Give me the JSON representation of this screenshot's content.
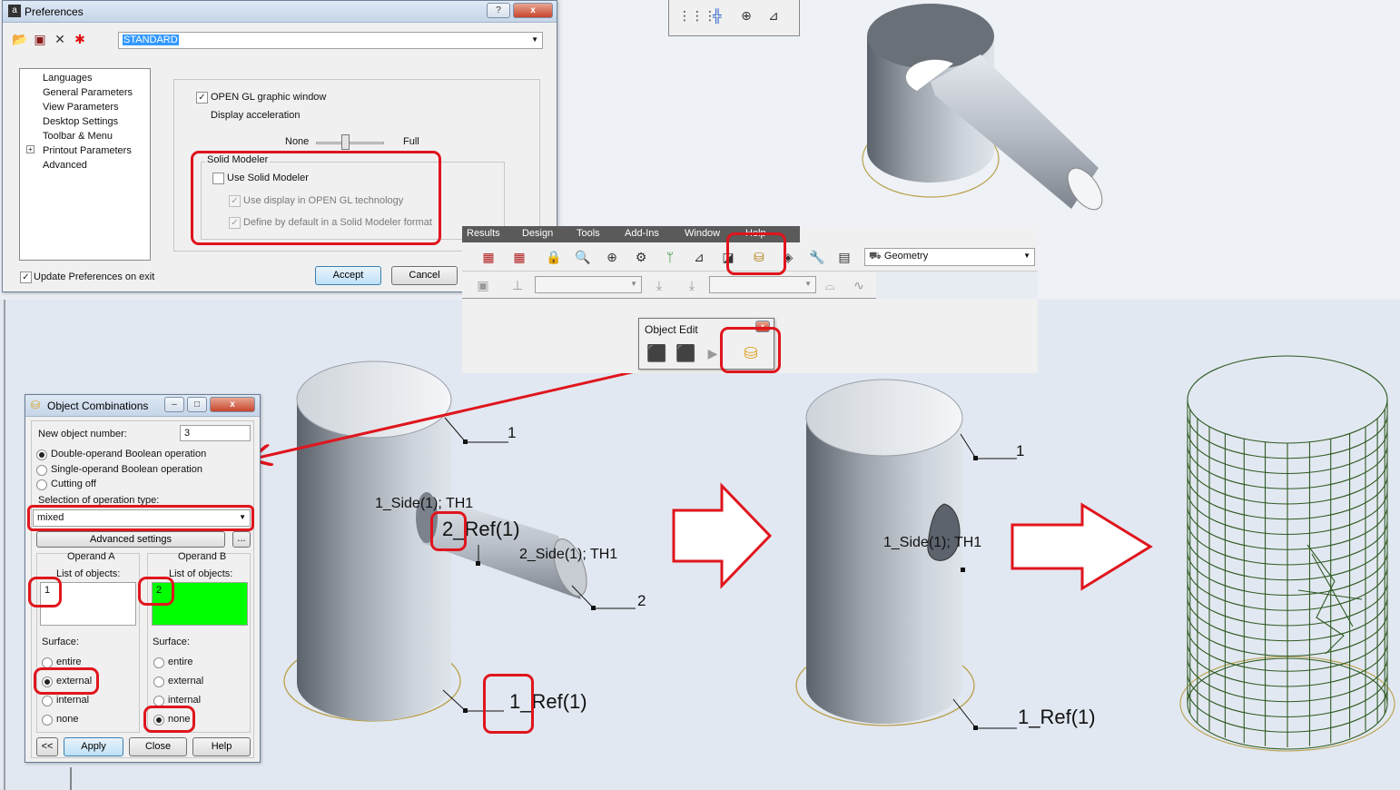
{
  "preferences": {
    "title": "Preferences",
    "help_btn": "?",
    "close_btn": "x",
    "preset": "STANDARD",
    "tree": [
      "Languages",
      "General Parameters",
      "View Parameters",
      "Desktop Settings",
      "Toolbar & Menu",
      "Printout Parameters",
      "Advanced"
    ],
    "tree_expand": "+",
    "open_gl": "OPEN GL graphic window",
    "display_accel": "Display acceleration",
    "slider_min": "None",
    "slider_max": "Full",
    "solid_group": "Solid Modeler",
    "use_solid": "Use Solid Modeler",
    "use_display": "Use display in OPEN GL technology",
    "define_default": "Define by default in a Solid Modeler format",
    "update_prefs": "Update Preferences on exit",
    "accept": "Accept",
    "cancel": "Cancel"
  },
  "menubar": {
    "items": [
      "Results",
      "Design",
      "Tools",
      "Add-Ins",
      "Window",
      "Help"
    ],
    "combo": "Geometry"
  },
  "object_edit": {
    "title": "Object Edit"
  },
  "combinations": {
    "title": "Object Combinations",
    "new_obj_label": "New object number:",
    "new_obj_value": "3",
    "radio_double": "Double-operand Boolean operation",
    "radio_single": "Single-operand Boolean operation",
    "radio_cut": "Cutting off",
    "selection_label": "Selection of operation type:",
    "selection_value": "mixed",
    "advanced": "Advanced settings",
    "ellipsis": "...",
    "operand_a": "Operand A",
    "operand_b": "Operand B",
    "list_label": "List of objects:",
    "list_a": "1",
    "list_b": "2",
    "surface": "Surface:",
    "entire": "entire",
    "external": "external",
    "internal": "internal",
    "none": "none",
    "back": "<<",
    "apply": "Apply",
    "close": "Close",
    "help": "Help"
  },
  "viewport": {
    "left_label_1": "1",
    "left_side": "1_Side(1); TH1",
    "left_ref2": "2_Ref(1)",
    "left_side2": "2_Side(1); TH1",
    "left_label_2": "2",
    "left_ref1": "1_Ref(1)",
    "mid_label_1": "1",
    "mid_side": "1_Side(1); TH1",
    "mid_ref1": "1_Ref(1)"
  },
  "colors": {
    "annotation_red": "#e0151d",
    "mesh_green": "#2f5a22",
    "operand_b_fill": "#00ff00"
  }
}
